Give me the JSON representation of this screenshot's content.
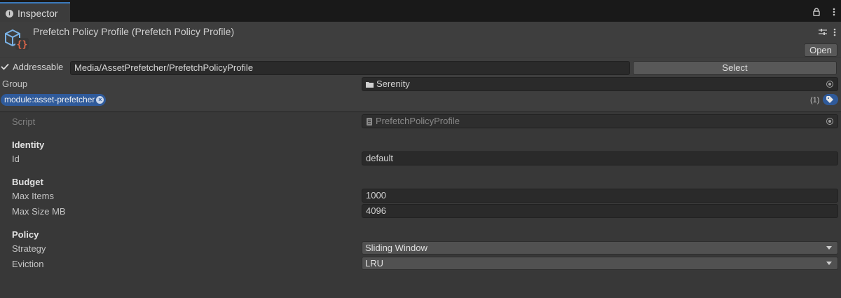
{
  "tab": {
    "label": "Inspector",
    "info_icon": "info-icon"
  },
  "window": {
    "lock_icon": "lock-icon",
    "menu_icon": "kebab-menu-icon"
  },
  "header": {
    "title": "Prefetch Policy Profile (Prefetch Policy Profile)",
    "asset_icon": "scriptable-object-icon",
    "open_label": "Open"
  },
  "addressable": {
    "checked": true,
    "label": "Addressable",
    "path": "Media/AssetPrefetcher/PrefetchPolicyProfile",
    "select_label": "Select"
  },
  "group": {
    "label": "Group",
    "value": "Serenity"
  },
  "labels": {
    "tag": "module:asset-prefetcher",
    "count": "(1)"
  },
  "script": {
    "label": "Script",
    "value": "PrefetchPolicyProfile"
  },
  "identity": {
    "heading": "Identity",
    "id_label": "Id",
    "id_value": "default"
  },
  "budget": {
    "heading": "Budget",
    "max_items_label": "Max Items",
    "max_items_value": "1000",
    "max_size_label": "Max Size MB",
    "max_size_value": "4096"
  },
  "policy": {
    "heading": "Policy",
    "strategy_label": "Strategy",
    "strategy_value": "Sliding Window",
    "eviction_label": "Eviction",
    "eviction_value": "LRU"
  },
  "colors": {
    "accent": "#3a79bb",
    "tag_bg": "#2f5a9a",
    "panel_bg": "#383838"
  }
}
